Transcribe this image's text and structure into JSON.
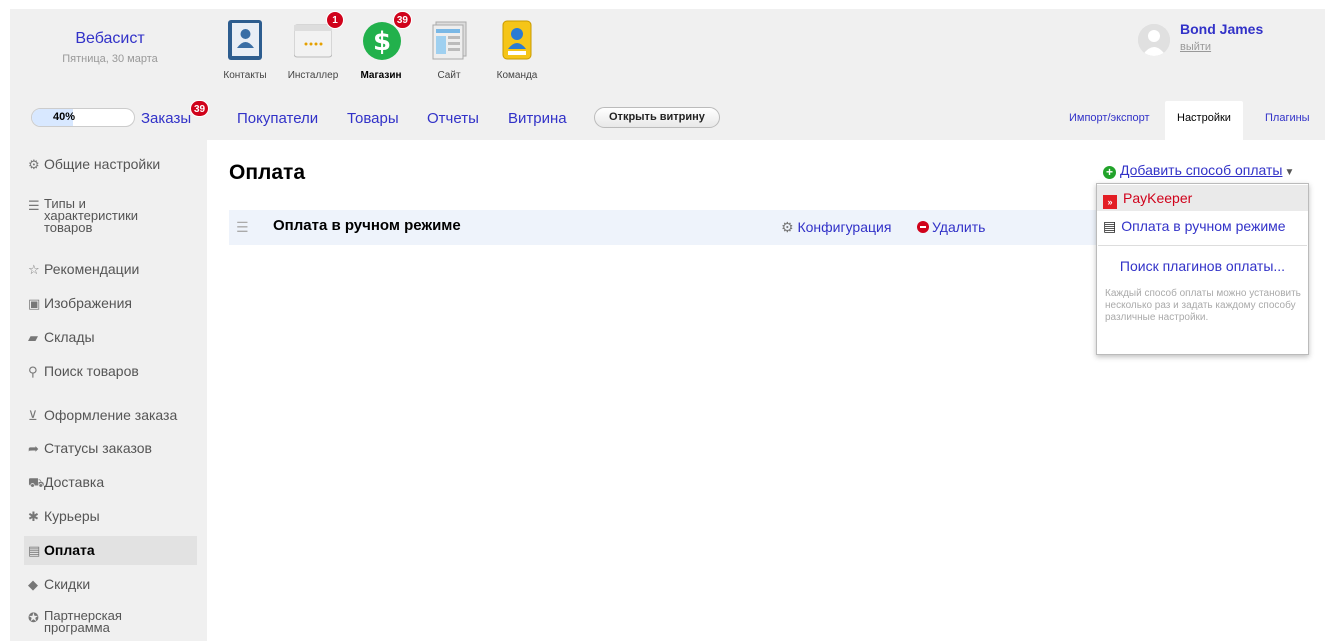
{
  "brand": {
    "name": "Вебасист",
    "date": "Пятница, 30 марта"
  },
  "apps": [
    {
      "label": "Контакты",
      "badge": ""
    },
    {
      "label": "Инсталлер",
      "badge": "1"
    },
    {
      "label": "Магазин",
      "badge": "39"
    },
    {
      "label": "Сайт",
      "badge": ""
    },
    {
      "label": "Команда",
      "badge": ""
    }
  ],
  "user": {
    "name": "Bond James",
    "logout": "выйти"
  },
  "nav": {
    "progress_text": "40%",
    "progress_value": 0.4,
    "orders": "Заказы",
    "orders_badge": "39",
    "customers": "Покупатели",
    "products": "Товары",
    "reports": "Отчеты",
    "storefront": "Витрина",
    "open_storefront": "Открыть витрину",
    "import_export": "Импорт/экспорт",
    "settings": "Настройки",
    "plugins": "Плагины"
  },
  "sidebar": {
    "items": [
      "Общие настройки",
      "Типы и",
      "характеристики",
      "товаров",
      "Рекомендации",
      "Изображения",
      "Склады",
      "Поиск товаров",
      "Оформление заказа",
      "Статусы заказов",
      "Доставка",
      "Курьеры",
      "Оплата",
      "Скидки",
      "Партнерская",
      "программа"
    ]
  },
  "main": {
    "title": "Оплата",
    "method_name": "Оплата в ручном режиме",
    "configure": "Конфигурация",
    "delete": "Удалить",
    "add_method": "Добавить способ оплаты"
  },
  "dropdown": {
    "items": [
      "PayKeeper",
      "Оплата в ручном режиме"
    ],
    "search": "Поиск плагинов оплаты...",
    "hint": "Каждый способ оплаты можно установить несколько раз и задать каждому способу различные настройки."
  },
  "colors": {
    "link": "#3232c8",
    "badge": "#d0021b",
    "add_icon": "#22a32a",
    "paykeeper": "#e31e24"
  }
}
